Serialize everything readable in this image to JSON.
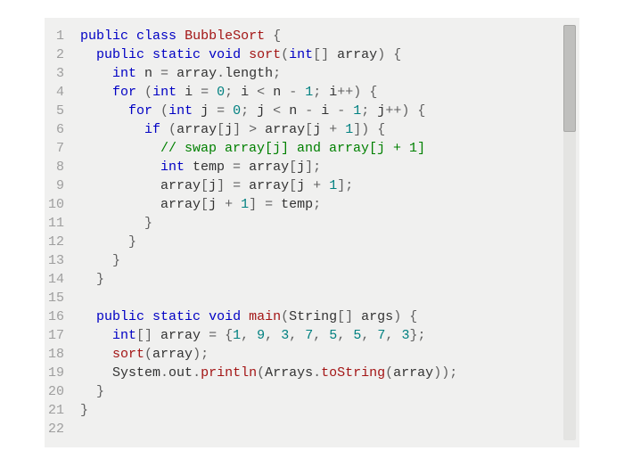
{
  "code": {
    "lines": [
      {
        "num": "1",
        "indent": "",
        "tokens": [
          {
            "t": "public",
            "c": "keyword"
          },
          {
            "t": " ",
            "c": "default"
          },
          {
            "t": "class",
            "c": "keyword"
          },
          {
            "t": " ",
            "c": "default"
          },
          {
            "t": "BubbleSort",
            "c": "classname"
          },
          {
            "t": " ",
            "c": "default"
          },
          {
            "t": "{",
            "c": "punct"
          }
        ]
      },
      {
        "num": "2",
        "indent": "  ",
        "tokens": [
          {
            "t": "public",
            "c": "keyword"
          },
          {
            "t": " ",
            "c": "default"
          },
          {
            "t": "static",
            "c": "keyword"
          },
          {
            "t": " ",
            "c": "default"
          },
          {
            "t": "void",
            "c": "keyword"
          },
          {
            "t": " ",
            "c": "default"
          },
          {
            "t": "sort",
            "c": "method"
          },
          {
            "t": "(",
            "c": "punct"
          },
          {
            "t": "int",
            "c": "type"
          },
          {
            "t": "[] ",
            "c": "punct"
          },
          {
            "t": "array",
            "c": "default"
          },
          {
            "t": ")",
            "c": "punct"
          },
          {
            "t": " ",
            "c": "default"
          },
          {
            "t": "{",
            "c": "punct"
          }
        ]
      },
      {
        "num": "3",
        "indent": "    ",
        "tokens": [
          {
            "t": "int",
            "c": "type"
          },
          {
            "t": " n ",
            "c": "default"
          },
          {
            "t": "=",
            "c": "punct"
          },
          {
            "t": " array",
            "c": "default"
          },
          {
            "t": ".",
            "c": "punct"
          },
          {
            "t": "length",
            "c": "default"
          },
          {
            "t": ";",
            "c": "punct"
          }
        ]
      },
      {
        "num": "4",
        "indent": "    ",
        "tokens": [
          {
            "t": "for",
            "c": "keyword"
          },
          {
            "t": " ",
            "c": "default"
          },
          {
            "t": "(",
            "c": "punct"
          },
          {
            "t": "int",
            "c": "type"
          },
          {
            "t": " i ",
            "c": "default"
          },
          {
            "t": "=",
            "c": "punct"
          },
          {
            "t": " ",
            "c": "default"
          },
          {
            "t": "0",
            "c": "number"
          },
          {
            "t": ";",
            "c": "punct"
          },
          {
            "t": " i ",
            "c": "default"
          },
          {
            "t": "<",
            "c": "punct"
          },
          {
            "t": " n ",
            "c": "default"
          },
          {
            "t": "-",
            "c": "punct"
          },
          {
            "t": " ",
            "c": "default"
          },
          {
            "t": "1",
            "c": "number"
          },
          {
            "t": ";",
            "c": "punct"
          },
          {
            "t": " i",
            "c": "default"
          },
          {
            "t": "++)",
            "c": "punct"
          },
          {
            "t": " ",
            "c": "default"
          },
          {
            "t": "{",
            "c": "punct"
          }
        ]
      },
      {
        "num": "5",
        "indent": "      ",
        "tokens": [
          {
            "t": "for",
            "c": "keyword"
          },
          {
            "t": " ",
            "c": "default"
          },
          {
            "t": "(",
            "c": "punct"
          },
          {
            "t": "int",
            "c": "type"
          },
          {
            "t": " j ",
            "c": "default"
          },
          {
            "t": "=",
            "c": "punct"
          },
          {
            "t": " ",
            "c": "default"
          },
          {
            "t": "0",
            "c": "number"
          },
          {
            "t": ";",
            "c": "punct"
          },
          {
            "t": " j ",
            "c": "default"
          },
          {
            "t": "<",
            "c": "punct"
          },
          {
            "t": " n ",
            "c": "default"
          },
          {
            "t": "-",
            "c": "punct"
          },
          {
            "t": " i ",
            "c": "default"
          },
          {
            "t": "-",
            "c": "punct"
          },
          {
            "t": " ",
            "c": "default"
          },
          {
            "t": "1",
            "c": "number"
          },
          {
            "t": ";",
            "c": "punct"
          },
          {
            "t": " j",
            "c": "default"
          },
          {
            "t": "++)",
            "c": "punct"
          },
          {
            "t": " ",
            "c": "default"
          },
          {
            "t": "{",
            "c": "punct"
          }
        ]
      },
      {
        "num": "6",
        "indent": "        ",
        "tokens": [
          {
            "t": "if",
            "c": "keyword"
          },
          {
            "t": " ",
            "c": "default"
          },
          {
            "t": "(",
            "c": "punct"
          },
          {
            "t": "array",
            "c": "default"
          },
          {
            "t": "[",
            "c": "punct"
          },
          {
            "t": "j",
            "c": "default"
          },
          {
            "t": "]",
            "c": "punct"
          },
          {
            "t": " ",
            "c": "default"
          },
          {
            "t": ">",
            "c": "punct"
          },
          {
            "t": " array",
            "c": "default"
          },
          {
            "t": "[",
            "c": "punct"
          },
          {
            "t": "j ",
            "c": "default"
          },
          {
            "t": "+",
            "c": "punct"
          },
          {
            "t": " ",
            "c": "default"
          },
          {
            "t": "1",
            "c": "number"
          },
          {
            "t": "])",
            "c": "punct"
          },
          {
            "t": " ",
            "c": "default"
          },
          {
            "t": "{",
            "c": "punct"
          }
        ]
      },
      {
        "num": "7",
        "indent": "          ",
        "tokens": [
          {
            "t": "// swap array[j] and array[j + 1]",
            "c": "comment"
          }
        ]
      },
      {
        "num": "8",
        "indent": "          ",
        "tokens": [
          {
            "t": "int",
            "c": "type"
          },
          {
            "t": " temp ",
            "c": "default"
          },
          {
            "t": "=",
            "c": "punct"
          },
          {
            "t": " array",
            "c": "default"
          },
          {
            "t": "[",
            "c": "punct"
          },
          {
            "t": "j",
            "c": "default"
          },
          {
            "t": "];",
            "c": "punct"
          }
        ]
      },
      {
        "num": "9",
        "indent": "          ",
        "tokens": [
          {
            "t": "array",
            "c": "default"
          },
          {
            "t": "[",
            "c": "punct"
          },
          {
            "t": "j",
            "c": "default"
          },
          {
            "t": "]",
            "c": "punct"
          },
          {
            "t": " ",
            "c": "default"
          },
          {
            "t": "=",
            "c": "punct"
          },
          {
            "t": " array",
            "c": "default"
          },
          {
            "t": "[",
            "c": "punct"
          },
          {
            "t": "j ",
            "c": "default"
          },
          {
            "t": "+",
            "c": "punct"
          },
          {
            "t": " ",
            "c": "default"
          },
          {
            "t": "1",
            "c": "number"
          },
          {
            "t": "];",
            "c": "punct"
          }
        ]
      },
      {
        "num": "10",
        "indent": "          ",
        "tokens": [
          {
            "t": "array",
            "c": "default"
          },
          {
            "t": "[",
            "c": "punct"
          },
          {
            "t": "j ",
            "c": "default"
          },
          {
            "t": "+",
            "c": "punct"
          },
          {
            "t": " ",
            "c": "default"
          },
          {
            "t": "1",
            "c": "number"
          },
          {
            "t": "]",
            "c": "punct"
          },
          {
            "t": " ",
            "c": "default"
          },
          {
            "t": "=",
            "c": "punct"
          },
          {
            "t": " temp",
            "c": "default"
          },
          {
            "t": ";",
            "c": "punct"
          }
        ]
      },
      {
        "num": "11",
        "indent": "        ",
        "tokens": [
          {
            "t": "}",
            "c": "punct"
          }
        ]
      },
      {
        "num": "12",
        "indent": "      ",
        "tokens": [
          {
            "t": "}",
            "c": "punct"
          }
        ]
      },
      {
        "num": "13",
        "indent": "    ",
        "tokens": [
          {
            "t": "}",
            "c": "punct"
          }
        ]
      },
      {
        "num": "14",
        "indent": "  ",
        "tokens": [
          {
            "t": "}",
            "c": "punct"
          }
        ]
      },
      {
        "num": "15",
        "indent": "",
        "tokens": []
      },
      {
        "num": "16",
        "indent": "  ",
        "tokens": [
          {
            "t": "public",
            "c": "keyword"
          },
          {
            "t": " ",
            "c": "default"
          },
          {
            "t": "static",
            "c": "keyword"
          },
          {
            "t": " ",
            "c": "default"
          },
          {
            "t": "void",
            "c": "keyword"
          },
          {
            "t": " ",
            "c": "default"
          },
          {
            "t": "main",
            "c": "method"
          },
          {
            "t": "(",
            "c": "punct"
          },
          {
            "t": "String",
            "c": "default"
          },
          {
            "t": "[] ",
            "c": "punct"
          },
          {
            "t": "args",
            "c": "default"
          },
          {
            "t": ")",
            "c": "punct"
          },
          {
            "t": " ",
            "c": "default"
          },
          {
            "t": "{",
            "c": "punct"
          }
        ]
      },
      {
        "num": "17",
        "indent": "    ",
        "tokens": [
          {
            "t": "int",
            "c": "type"
          },
          {
            "t": "[] ",
            "c": "punct"
          },
          {
            "t": "array ",
            "c": "default"
          },
          {
            "t": "=",
            "c": "punct"
          },
          {
            "t": " ",
            "c": "default"
          },
          {
            "t": "{",
            "c": "punct"
          },
          {
            "t": "1",
            "c": "number"
          },
          {
            "t": ",",
            "c": "punct"
          },
          {
            "t": " ",
            "c": "default"
          },
          {
            "t": "9",
            "c": "number"
          },
          {
            "t": ",",
            "c": "punct"
          },
          {
            "t": " ",
            "c": "default"
          },
          {
            "t": "3",
            "c": "number"
          },
          {
            "t": ",",
            "c": "punct"
          },
          {
            "t": " ",
            "c": "default"
          },
          {
            "t": "7",
            "c": "number"
          },
          {
            "t": ",",
            "c": "punct"
          },
          {
            "t": " ",
            "c": "default"
          },
          {
            "t": "5",
            "c": "number"
          },
          {
            "t": ",",
            "c": "punct"
          },
          {
            "t": " ",
            "c": "default"
          },
          {
            "t": "5",
            "c": "number"
          },
          {
            "t": ",",
            "c": "punct"
          },
          {
            "t": " ",
            "c": "default"
          },
          {
            "t": "7",
            "c": "number"
          },
          {
            "t": ",",
            "c": "punct"
          },
          {
            "t": " ",
            "c": "default"
          },
          {
            "t": "3",
            "c": "number"
          },
          {
            "t": "};",
            "c": "punct"
          }
        ]
      },
      {
        "num": "18",
        "indent": "    ",
        "tokens": [
          {
            "t": "sort",
            "c": "call"
          },
          {
            "t": "(",
            "c": "punct"
          },
          {
            "t": "array",
            "c": "default"
          },
          {
            "t": ");",
            "c": "punct"
          }
        ]
      },
      {
        "num": "19",
        "indent": "    ",
        "tokens": [
          {
            "t": "System",
            "c": "default"
          },
          {
            "t": ".",
            "c": "punct"
          },
          {
            "t": "out",
            "c": "default"
          },
          {
            "t": ".",
            "c": "punct"
          },
          {
            "t": "println",
            "c": "call"
          },
          {
            "t": "(",
            "c": "punct"
          },
          {
            "t": "Arrays",
            "c": "default"
          },
          {
            "t": ".",
            "c": "punct"
          },
          {
            "t": "toString",
            "c": "call"
          },
          {
            "t": "(",
            "c": "punct"
          },
          {
            "t": "array",
            "c": "default"
          },
          {
            "t": "));",
            "c": "punct"
          }
        ]
      },
      {
        "num": "20",
        "indent": "  ",
        "tokens": [
          {
            "t": "}",
            "c": "punct"
          }
        ]
      },
      {
        "num": "21",
        "indent": "",
        "tokens": [
          {
            "t": "}",
            "c": "punct"
          }
        ]
      },
      {
        "num": "22",
        "indent": "",
        "tokens": []
      }
    ]
  }
}
